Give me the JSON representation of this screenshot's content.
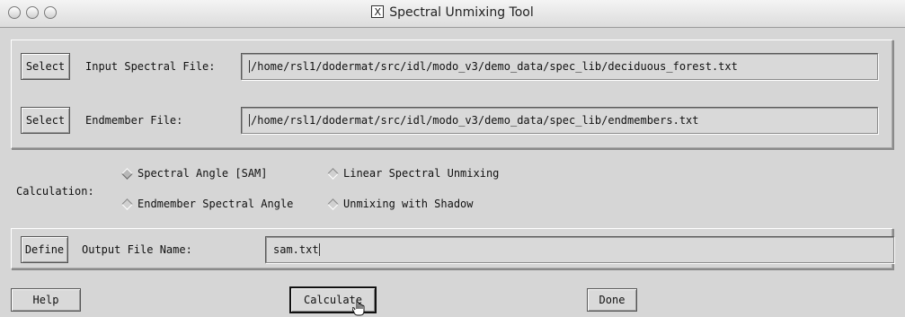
{
  "window": {
    "title": "Spectral Unmixing Tool"
  },
  "input_section": {
    "input_file": {
      "button": "Select",
      "label": "Input Spectral File:",
      "value": "/home/rsl1/dodermat/src/idl/modo_v3/demo_data/spec_lib/deciduous_forest.txt"
    },
    "endmember_file": {
      "button": "Select",
      "label": "Endmember File:",
      "value": "/home/rsl1/dodermat/src/idl/modo_v3/demo_data/spec_lib/endmembers.txt"
    }
  },
  "calculation": {
    "label": "Calculation:",
    "options": [
      {
        "label": "Spectral Angle [SAM]",
        "selected": true
      },
      {
        "label": "Linear Spectral Unmixing",
        "selected": false
      },
      {
        "label": "Endmember Spectral Angle",
        "selected": false
      },
      {
        "label": "Unmixing with Shadow",
        "selected": false
      }
    ]
  },
  "output": {
    "button": "Define",
    "label": "Output File Name:",
    "value": "sam.txt"
  },
  "footer": {
    "help": "Help",
    "calculate": "Calculate",
    "done": "Done"
  }
}
